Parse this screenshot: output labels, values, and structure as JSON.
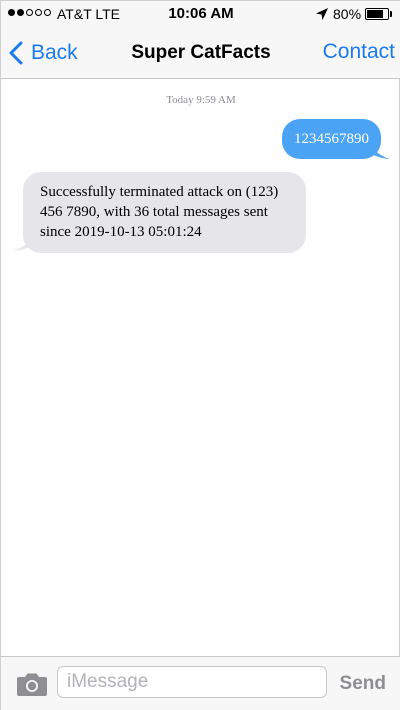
{
  "status_bar": {
    "carrier": "AT&T LTE",
    "time": "10:06 AM",
    "battery_percent": "80%",
    "battery_level": 0.8,
    "signal_bars_filled": 2,
    "signal_bars_total": 5,
    "location_icon": "location-arrow-icon"
  },
  "nav": {
    "back_label": "Back",
    "title": "Super CatFacts",
    "contact_label": "Contact"
  },
  "conversation": {
    "timestamp": "Today 9:59 AM",
    "messages": [
      {
        "direction": "outgoing",
        "text": "1234567890"
      },
      {
        "direction": "incoming",
        "text": "Successfully terminated attack on (123) 456 7890, with 36 total messages sent since 2019-10-13 05:01:24"
      }
    ]
  },
  "input_bar": {
    "camera_icon": "camera-icon",
    "placeholder": "iMessage",
    "value": "",
    "send_label": "Send"
  },
  "colors": {
    "accent": "#1a7bf0",
    "outgoing_bubble": "#4aa3f5",
    "incoming_bubble": "#e5e5ea",
    "bar_background": "#f7f7f7"
  }
}
